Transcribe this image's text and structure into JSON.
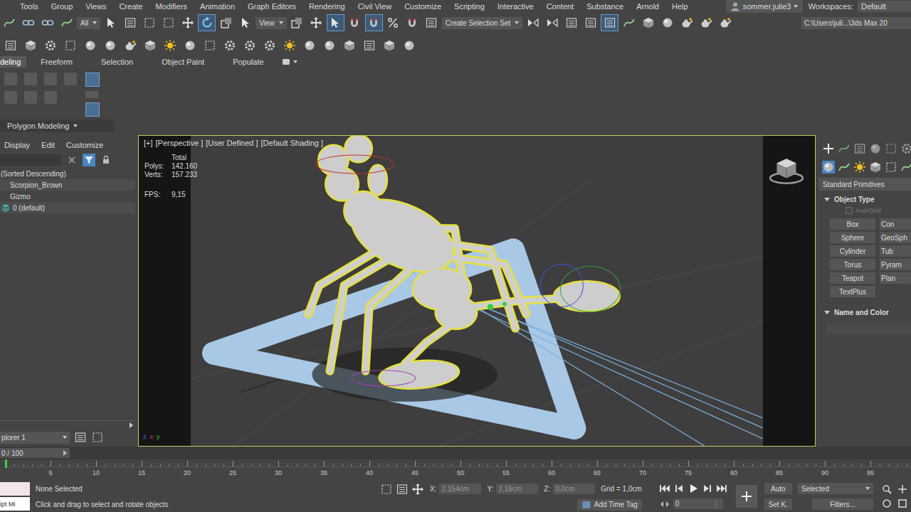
{
  "menubar": {
    "items": [
      "Tools",
      "Group",
      "Views",
      "Create",
      "Modifiers",
      "Animation",
      "Graph Editors",
      "Rendering",
      "Civil View",
      "Customize",
      "Scripting",
      "Interactive",
      "Content",
      "Substance",
      "Arnold",
      "Help"
    ],
    "user": "sommer.julie3",
    "workspaces_label": "Workspaces:",
    "workspace": "Default"
  },
  "main_toolbar": {
    "items": [
      {
        "kind": "button",
        "active": false
      },
      {
        "kind": "button",
        "active": false
      },
      {
        "kind": "button",
        "active": false
      },
      {
        "kind": "button",
        "active": false
      },
      {
        "kind": "dropdown",
        "value": "All"
      },
      {
        "kind": "button",
        "active": false
      },
      {
        "kind": "button",
        "active": false
      },
      {
        "kind": "button",
        "active": false
      },
      {
        "kind": "button",
        "active": false
      },
      {
        "kind": "button",
        "active": false
      },
      {
        "kind": "button",
        "active": true
      },
      {
        "kind": "button",
        "active": false
      },
      {
        "kind": "button",
        "active": false
      },
      {
        "kind": "dropdown",
        "value": "View"
      },
      {
        "kind": "button",
        "active": false
      },
      {
        "kind": "button",
        "active": false
      },
      {
        "kind": "button",
        "active": true
      },
      {
        "kind": "button",
        "active": false
      },
      {
        "kind": "button",
        "active": true
      },
      {
        "kind": "button",
        "active": false
      },
      {
        "kind": "button",
        "active": false
      },
      {
        "kind": "button",
        "active": false
      },
      {
        "kind": "dropdown",
        "value": "Create Selection Set"
      },
      {
        "kind": "button",
        "active": false
      },
      {
        "kind": "button",
        "active": false
      },
      {
        "kind": "button",
        "active": false
      },
      {
        "kind": "button",
        "active": false
      },
      {
        "kind": "button",
        "active": true
      },
      {
        "kind": "button",
        "active": false
      },
      {
        "kind": "button",
        "active": false
      },
      {
        "kind": "button",
        "active": false
      },
      {
        "kind": "button",
        "active": false
      },
      {
        "kind": "button",
        "active": false
      },
      {
        "kind": "button",
        "active": false
      }
    ],
    "path": "C:\\Users\\juli...\\3ds Max 20"
  },
  "ribbon": {
    "tabs": [
      {
        "label": "deling",
        "selected": true
      },
      {
        "label": "Freeform",
        "selected": false
      },
      {
        "label": "Selection",
        "selected": false
      },
      {
        "label": "Object Paint",
        "selected": false
      },
      {
        "label": "Populate",
        "selected": false
      }
    ],
    "panel_label": "Polygon Modeling"
  },
  "scene_explorer": {
    "menu": [
      "Display",
      "Edit",
      "Customize"
    ],
    "filter_active": true,
    "sort_label": "(Sorted Descending)",
    "items": [
      {
        "name": "Scorpion_Brown",
        "kind": "object",
        "selected": false
      },
      {
        "name": "Gizmo",
        "kind": "object",
        "selected": false
      },
      {
        "name": "0 (default)",
        "kind": "layer",
        "selected": false
      }
    ],
    "explorer_name": "plorer 1"
  },
  "viewport": {
    "labels": [
      "[+]",
      "[Perspective ]",
      "[User Defined ]",
      "[Default Shading ]"
    ],
    "active": true,
    "stats": {
      "title": "Total",
      "rows": [
        {
          "label": "Polys:",
          "value": "142.160"
        },
        {
          "label": "Verts:",
          "value": "157.233"
        }
      ],
      "fps_label": "FPS:",
      "fps": "9,15"
    },
    "axes": [
      {
        "label": "z",
        "color": "#4a6cff"
      },
      {
        "label": "x",
        "color": "#e03030"
      },
      {
        "label": "y",
        "color": "#30c030"
      }
    ]
  },
  "command_panel": {
    "tabs": [
      {
        "selected": true
      },
      {
        "selected": false
      },
      {
        "selected": false
      },
      {
        "selected": false
      },
      {
        "selected": false
      },
      {
        "selected": false
      }
    ],
    "categories": [
      {
        "selected": true
      },
      {
        "selected": false
      },
      {
        "selected": false
      },
      {
        "selected": false
      },
      {
        "selected": false
      },
      {
        "selected": false
      },
      {
        "selected": false
      }
    ],
    "dropdown": "Standard Primitives",
    "rollouts": [
      {
        "title": "Object Type",
        "expanded": true
      },
      {
        "title": "Name and Color",
        "expanded": true
      }
    ],
    "autogrid": {
      "label": "AutoGrid",
      "checked": false,
      "disabled": true
    },
    "buttons": [
      "Box",
      "Con",
      "Sphere",
      "GeoSph",
      "Cylinder",
      "Tub",
      "Torus",
      "Pyram",
      "Teapot",
      "Plan",
      "TextPlus"
    ]
  },
  "time_slider": {
    "label": "0 / 100",
    "level": 0
  },
  "timeline": {
    "ticks": [
      "5",
      "10",
      "15",
      "20",
      "25",
      "30",
      "35",
      "40",
      "45",
      "50",
      "55",
      "60",
      "65",
      "70",
      "75",
      "80",
      "85",
      "90",
      "95"
    ],
    "current_frame_level": 0
  },
  "status_bar": {
    "listener": "ipt Mi",
    "selection": "None Selected",
    "prompt": "Click and drag to select and rotate objects",
    "coords": [
      {
        "axis": "X:",
        "value": "2,154cm"
      },
      {
        "axis": "Y:",
        "value": "2,16cm"
      },
      {
        "axis": "Z:",
        "value": "0,0cm"
      }
    ],
    "grid": "Grid = 1,0cm",
    "time_tag": "Add Time Tag",
    "frame": "0",
    "auto_key": {
      "label": "Auto",
      "on": false
    },
    "set_key": "Set K.",
    "key_mode": "Selected",
    "filters": "Filters..."
  }
}
